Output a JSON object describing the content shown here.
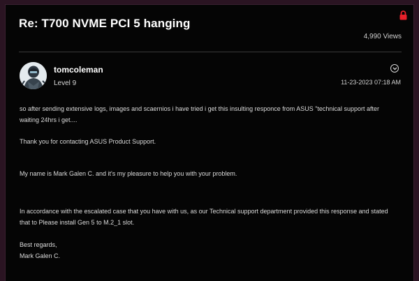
{
  "thread": {
    "title": "Re: T700 NVME PCI 5 hanging",
    "views": "4,990 Views"
  },
  "author": {
    "name": "tomcoleman",
    "rank": "Level 9"
  },
  "post": {
    "date": "11-23-2023",
    "time": "07:18 AM",
    "paragraphs": [
      "so after sending extensive logs, images and scaernios i have tried i get this insulting responce from ASUS \"technical support after waiting 24hrs i get....",
      "Thank you for contacting ASUS Product Support.",
      "My name is Mark Galen C. and it's my pleasure to help you with your problem.",
      "In accordance with the escalated case that you have with us, as our Technical support department provided this response and stated that to Please install Gen 5 to M.2_1 slot.",
      "Best regards,",
      "Mark Galen C."
    ]
  },
  "icons": {
    "lock": "lock-icon",
    "options": "chevron-down-icon",
    "avatar": "user-avatar"
  },
  "colors": {
    "background": "#050505",
    "frame": "#2a1422",
    "lock": "#e8202a",
    "text": "#e6e6e6"
  }
}
